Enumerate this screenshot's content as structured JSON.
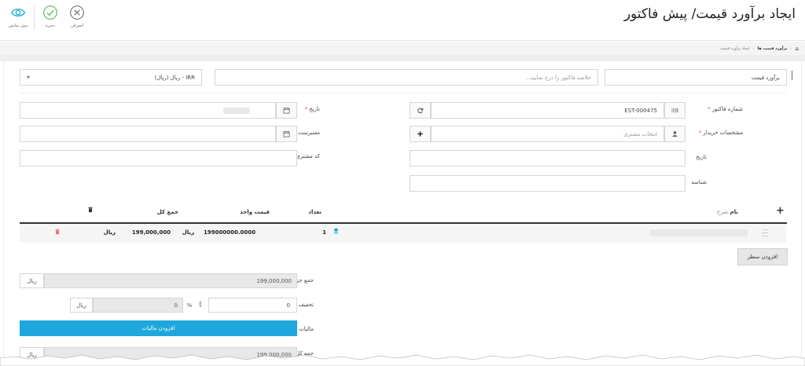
{
  "header": {
    "title": "ایجاد برآورد قیمت/ پیش فاکتور",
    "actions": {
      "preview": "پیش نمایش",
      "save": "ذخیره",
      "cancel": "انصراف"
    }
  },
  "breadcrumb": {
    "items": [
      "برآورد قیمت ها",
      "ایجاد برآورد قیمت"
    ]
  },
  "top_row": {
    "doc_type": "برآورد قیمت",
    "summary_placeholder": "خلاصه فاکتور را درج نمایید...",
    "currency": "IRR - ریال (ریال)"
  },
  "form": {
    "invoice_number_label": "شماره فاکتور",
    "invoice_number_value": "EST-000475",
    "date_label": "تاریخ",
    "buyer_label": "مشخصات خریدار",
    "buyer_placeholder": "انتخاب مشتری",
    "valid_until_label": "معتبرست تا",
    "date2_label": "تاریخ",
    "customer_code_label": "کد مشتری",
    "identifier_label": "شناسه"
  },
  "table": {
    "headers": {
      "name": "نام",
      "description": "شرح",
      "quantity": "تعداد",
      "unit_price": "قیمت واحد",
      "total": "جمع کل"
    },
    "rows": [
      {
        "quantity": "1",
        "unit_price": "199000000.0000",
        "unit_price_currency": "ریال",
        "total": "199,000,000",
        "total_currency": "ریال"
      }
    ],
    "add_row": "افزودن سطر"
  },
  "totals": {
    "subtotal_label": "جمع جزء",
    "subtotal_value": "199,000,000",
    "subtotal_unit": "ریال",
    "discount_label": "تخفیف",
    "discount_value": "0",
    "discount_percent_value": "0",
    "discount_percent_sign": "%",
    "discount_unit": "ریال",
    "tax_label": "مالیات",
    "add_tax": "افزودن مالیات",
    "grand_total_label": "جمع کل",
    "grand_total_value": "199,000,000",
    "grand_total_unit": "ریال"
  },
  "colors": {
    "accent_blue": "#1ea7dc",
    "save_green": "#5cb85c",
    "preview_teal": "#1ea7dc",
    "delete_red": "#e57373"
  }
}
